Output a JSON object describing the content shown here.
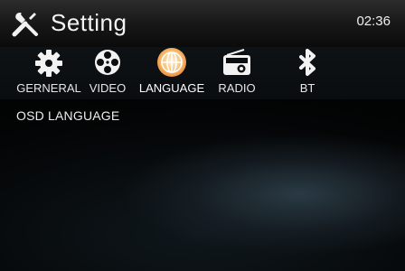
{
  "header": {
    "title": "Setting",
    "time": "02:36"
  },
  "tabs": [
    {
      "id": "general",
      "label": "GERNERAL",
      "icon": "gear-icon",
      "active": false
    },
    {
      "id": "video",
      "label": "VIDEO",
      "icon": "film-reel-icon",
      "active": false
    },
    {
      "id": "language",
      "label": "LANGUAGE",
      "icon": "globe-icon",
      "active": true
    },
    {
      "id": "radio",
      "label": "RADIO",
      "icon": "radio-icon",
      "active": false
    },
    {
      "id": "bt",
      "label": "BT",
      "icon": "bluetooth-icon",
      "active": false
    }
  ],
  "content": {
    "section_label": "OSD LANGUAGE"
  },
  "colors": {
    "active_tab_highlight": "#f5a040",
    "header_bg": "#1c1c1c"
  }
}
